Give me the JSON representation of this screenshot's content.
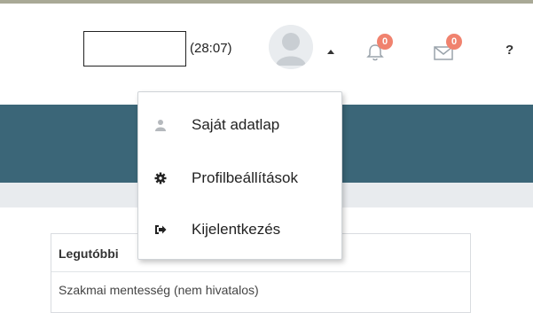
{
  "header": {
    "timer": "(28:07)",
    "notifications_count": "0",
    "messages_count": "0",
    "help_label": "?"
  },
  "user_menu": {
    "items": [
      {
        "label": "Saját adatlap",
        "icon": "user-icon"
      },
      {
        "label": "Profilbeállítások",
        "icon": "gear-icon"
      },
      {
        "label": "Kijelentkezés",
        "icon": "sign-out-icon"
      }
    ]
  },
  "recent_card": {
    "heading": "Legutóbbi",
    "row": "Szakmai mentesség (nem hivatalos)"
  },
  "colors": {
    "band": "#3b6678",
    "badge": "#f0826e"
  }
}
